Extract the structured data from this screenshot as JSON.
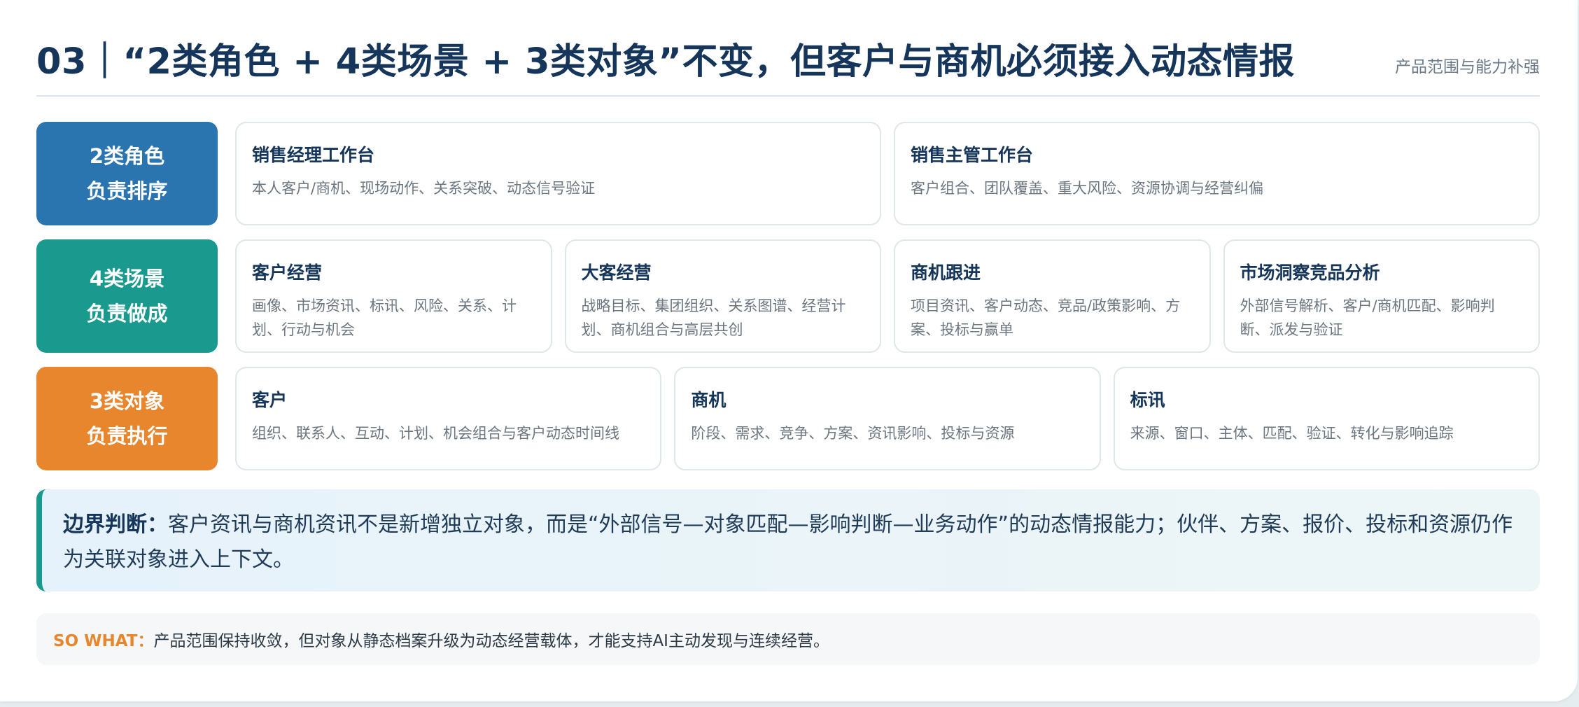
{
  "header": {
    "title": "03｜“2类角色 + 4类场景 + 3类对象”不变，但客户与商机必须接入动态情报",
    "subtitle": "产品范围与能力补强"
  },
  "rows": {
    "roles": {
      "label_line1": "2类角色",
      "label_line2": "负责排序",
      "color": "#2a74b0",
      "items": [
        {
          "title": "销售经理工作台",
          "desc": "本人客户/商机、现场动作、关系突破、动态信号验证"
        },
        {
          "title": "销售主管工作台",
          "desc": "客户组合、团队覆盖、重大风险、资源协调与经营纠偏"
        }
      ]
    },
    "scenes": {
      "label_line1": "4类场景",
      "label_line2": "负责做成",
      "color": "#1a9a8e",
      "items": [
        {
          "title": "客户经营",
          "desc": "画像、市场资讯、标讯、风险、关系、计划、行动与机会"
        },
        {
          "title": "大客经营",
          "desc": "战略目标、集团组织、关系图谱、经营计划、商机组合与高层共创"
        },
        {
          "title": "商机跟进",
          "desc": "项目资讯、客户动态、竞品/政策影响、方案、投标与赢单"
        },
        {
          "title": "市场洞察竞品分析",
          "desc": "外部信号解析、客户/商机匹配、影响判断、派发与验证"
        }
      ]
    },
    "objects": {
      "label_line1": "3类对象",
      "label_line2": "负责执行",
      "color": "#e8862e",
      "items": [
        {
          "title": "客户",
          "desc": "组织、联系人、互动、计划、机会组合与客户动态时间线"
        },
        {
          "title": "商机",
          "desc": "阶段、需求、竞争、方案、资讯影响、投标与资源"
        },
        {
          "title": "标讯",
          "desc": "来源、窗口、主体、匹配、验证、转化与影响追踪"
        }
      ]
    }
  },
  "boundary": {
    "key": "边界判断：",
    "text": "客户资讯与商机资讯不是新增独立对象，而是“外部信号—对象匹配—影响判断—业务动作”的动态情报能力；伙伴、方案、报价、投标和资源仍作为关联对象进入上下文。"
  },
  "sowhat": {
    "key": "SO WHAT：",
    "text": "产品范围保持收敛，但对象从静态档案升级为动态经营载体，才能支持AI主动发现与连续经营。"
  }
}
